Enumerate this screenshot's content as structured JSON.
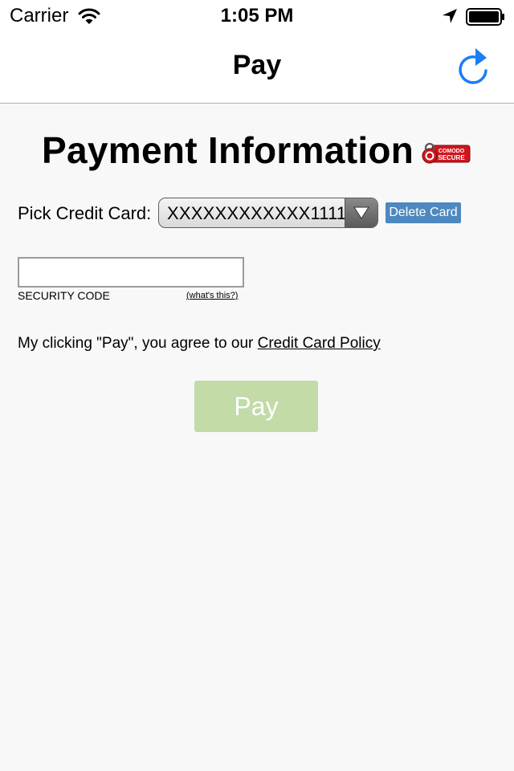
{
  "status_bar": {
    "carrier": "Carrier",
    "time": "1:05 PM",
    "icons": [
      "wifi-icon",
      "location-icon",
      "battery-icon"
    ]
  },
  "nav_bar": {
    "title": "Pay",
    "refresh_icon": "refresh-icon"
  },
  "content": {
    "heading": "Payment Information",
    "seal": {
      "line1": "COMODO",
      "line2": "SECURE"
    },
    "card_picker": {
      "label": "Pick Credit Card:",
      "selected_value": "XXXXXXXXXXXX1111",
      "delete_label": "Delete Card"
    },
    "security_code": {
      "value": "",
      "label": "SECURITY CODE",
      "help_link": "(what's this?)"
    },
    "agreement": {
      "text": "My clicking \"Pay\", you agree to our",
      "link": "Credit Card Policy"
    },
    "pay_button": "Pay"
  },
  "colors": {
    "accent_blue": "#1a7ef5",
    "delete_button": "#4d88c0",
    "pay_button": "#c2dba7",
    "seal_red": "#d0151e",
    "background": "#f8f8f8"
  }
}
